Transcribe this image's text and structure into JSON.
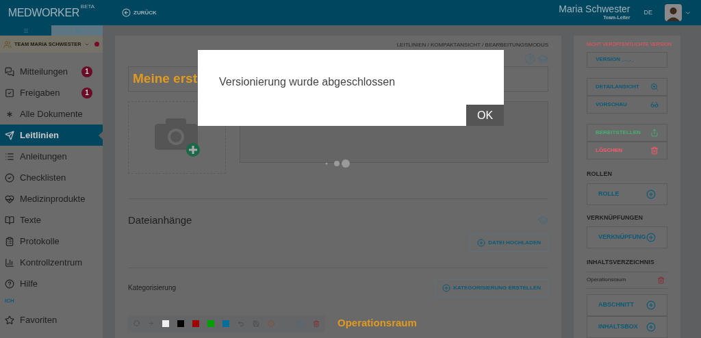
{
  "header": {
    "logo": "MEDWORKER",
    "logo_badge": "BETA",
    "back": "ZURÜCK",
    "user_name": "Maria Schwester",
    "user_role": "Team-Leiter",
    "language": "DE"
  },
  "sidebar": {
    "tabs": [
      {
        "kind": "list",
        "selected": true
      },
      {
        "kind": "settings",
        "selected": false
      }
    ],
    "team": "TEAM MARIA SCHWESTER",
    "items": [
      {
        "label": "Mitteilungen",
        "badge": "1",
        "selected": false
      },
      {
        "label": "Freigaben",
        "badge": "1",
        "selected": false
      },
      {
        "label": "Alle Dokumente",
        "selected": false
      },
      {
        "label": "Leitlinien",
        "selected": true
      },
      {
        "label": "Anleitungen",
        "selected": false
      },
      {
        "label": "Checklisten",
        "selected": false
      },
      {
        "label": "Medizinprodukte",
        "selected": false
      },
      {
        "label": "Texte",
        "selected": false
      },
      {
        "label": "Protokolle",
        "selected": false
      },
      {
        "label": "Kontrollzentrum",
        "selected": false
      },
      {
        "label": "Hilfe",
        "selected": false
      }
    ],
    "section": "ICH",
    "section_items": [
      {
        "label": "Favoriten",
        "selected": false
      }
    ]
  },
  "main": {
    "breadcrumb": "LEITLINIEN / KOMPAKTANSICHT / BEARBEITUNGSMODUS",
    "title": "Meine erst",
    "attachments_heading": "Dateianhänge",
    "upload_button": "DATEI HOCHLADEN",
    "categorization_label": "Kategorisierung",
    "categorization_button": "KATEGORISIERUNG ERSTELLEN",
    "section_heading": "Operationsraum",
    "swatches": [
      {
        "color": "#f0f0f0"
      },
      {
        "color": "#000000"
      },
      {
        "color": "#a00000"
      },
      {
        "color": "#00a000"
      },
      {
        "color": "#006e9a"
      }
    ]
  },
  "right_panel": {
    "status": "NICHT VERÖFFENTLICHTE VERSION",
    "version": "VERSION _._._",
    "action_groups": [
      [
        {
          "label": "DETAILANSICHT",
          "kind": "normal"
        },
        {
          "label": "VORSCHAU",
          "kind": "normal"
        }
      ],
      [
        {
          "label": "BEREITSTELLEN",
          "kind": "success"
        },
        {
          "label": "LÖSCHEN",
          "kind": "danger"
        }
      ]
    ],
    "roles_heading": "ROLLEN",
    "role_button": "ROLLE",
    "links_heading": "VERKNÜPFUNGEN",
    "link_button": "VERKNÜPFUNG",
    "toc_heading": "INHALTSVERZEICHNIS",
    "toc_items": [
      "Operationsraum"
    ],
    "toc_buttons": [
      "ABSCHNITT",
      "INHALTSBOX"
    ]
  },
  "dialog": {
    "message": "Versionierung wurde abgeschlossen",
    "ok": "OK"
  }
}
